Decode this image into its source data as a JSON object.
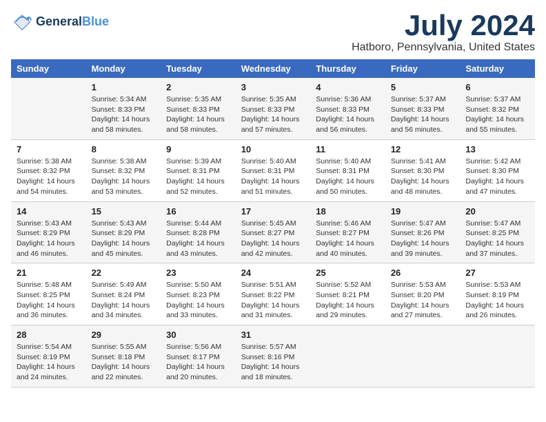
{
  "header": {
    "logo_line1": "General",
    "logo_line2": "Blue",
    "month_title": "July 2024",
    "location": "Hatboro, Pennsylvania, United States"
  },
  "weekdays": [
    "Sunday",
    "Monday",
    "Tuesday",
    "Wednesday",
    "Thursday",
    "Friday",
    "Saturday"
  ],
  "weeks": [
    [
      {
        "day": "",
        "sunrise": "",
        "sunset": "",
        "daylight": ""
      },
      {
        "day": "1",
        "sunrise": "Sunrise: 5:34 AM",
        "sunset": "Sunset: 8:33 PM",
        "daylight": "Daylight: 14 hours and 58 minutes."
      },
      {
        "day": "2",
        "sunrise": "Sunrise: 5:35 AM",
        "sunset": "Sunset: 8:33 PM",
        "daylight": "Daylight: 14 hours and 58 minutes."
      },
      {
        "day": "3",
        "sunrise": "Sunrise: 5:35 AM",
        "sunset": "Sunset: 8:33 PM",
        "daylight": "Daylight: 14 hours and 57 minutes."
      },
      {
        "day": "4",
        "sunrise": "Sunrise: 5:36 AM",
        "sunset": "Sunset: 8:33 PM",
        "daylight": "Daylight: 14 hours and 56 minutes."
      },
      {
        "day": "5",
        "sunrise": "Sunrise: 5:37 AM",
        "sunset": "Sunset: 8:33 PM",
        "daylight": "Daylight: 14 hours and 56 minutes."
      },
      {
        "day": "6",
        "sunrise": "Sunrise: 5:37 AM",
        "sunset": "Sunset: 8:32 PM",
        "daylight": "Daylight: 14 hours and 55 minutes."
      }
    ],
    [
      {
        "day": "7",
        "sunrise": "Sunrise: 5:38 AM",
        "sunset": "Sunset: 8:32 PM",
        "daylight": "Daylight: 14 hours and 54 minutes."
      },
      {
        "day": "8",
        "sunrise": "Sunrise: 5:38 AM",
        "sunset": "Sunset: 8:32 PM",
        "daylight": "Daylight: 14 hours and 53 minutes."
      },
      {
        "day": "9",
        "sunrise": "Sunrise: 5:39 AM",
        "sunset": "Sunset: 8:31 PM",
        "daylight": "Daylight: 14 hours and 52 minutes."
      },
      {
        "day": "10",
        "sunrise": "Sunrise: 5:40 AM",
        "sunset": "Sunset: 8:31 PM",
        "daylight": "Daylight: 14 hours and 51 minutes."
      },
      {
        "day": "11",
        "sunrise": "Sunrise: 5:40 AM",
        "sunset": "Sunset: 8:31 PM",
        "daylight": "Daylight: 14 hours and 50 minutes."
      },
      {
        "day": "12",
        "sunrise": "Sunrise: 5:41 AM",
        "sunset": "Sunset: 8:30 PM",
        "daylight": "Daylight: 14 hours and 48 minutes."
      },
      {
        "day": "13",
        "sunrise": "Sunrise: 5:42 AM",
        "sunset": "Sunset: 8:30 PM",
        "daylight": "Daylight: 14 hours and 47 minutes."
      }
    ],
    [
      {
        "day": "14",
        "sunrise": "Sunrise: 5:43 AM",
        "sunset": "Sunset: 8:29 PM",
        "daylight": "Daylight: 14 hours and 46 minutes."
      },
      {
        "day": "15",
        "sunrise": "Sunrise: 5:43 AM",
        "sunset": "Sunset: 8:29 PM",
        "daylight": "Daylight: 14 hours and 45 minutes."
      },
      {
        "day": "16",
        "sunrise": "Sunrise: 5:44 AM",
        "sunset": "Sunset: 8:28 PM",
        "daylight": "Daylight: 14 hours and 43 minutes."
      },
      {
        "day": "17",
        "sunrise": "Sunrise: 5:45 AM",
        "sunset": "Sunset: 8:27 PM",
        "daylight": "Daylight: 14 hours and 42 minutes."
      },
      {
        "day": "18",
        "sunrise": "Sunrise: 5:46 AM",
        "sunset": "Sunset: 8:27 PM",
        "daylight": "Daylight: 14 hours and 40 minutes."
      },
      {
        "day": "19",
        "sunrise": "Sunrise: 5:47 AM",
        "sunset": "Sunset: 8:26 PM",
        "daylight": "Daylight: 14 hours and 39 minutes."
      },
      {
        "day": "20",
        "sunrise": "Sunrise: 5:47 AM",
        "sunset": "Sunset: 8:25 PM",
        "daylight": "Daylight: 14 hours and 37 minutes."
      }
    ],
    [
      {
        "day": "21",
        "sunrise": "Sunrise: 5:48 AM",
        "sunset": "Sunset: 8:25 PM",
        "daylight": "Daylight: 14 hours and 36 minutes."
      },
      {
        "day": "22",
        "sunrise": "Sunrise: 5:49 AM",
        "sunset": "Sunset: 8:24 PM",
        "daylight": "Daylight: 14 hours and 34 minutes."
      },
      {
        "day": "23",
        "sunrise": "Sunrise: 5:50 AM",
        "sunset": "Sunset: 8:23 PM",
        "daylight": "Daylight: 14 hours and 33 minutes."
      },
      {
        "day": "24",
        "sunrise": "Sunrise: 5:51 AM",
        "sunset": "Sunset: 8:22 PM",
        "daylight": "Daylight: 14 hours and 31 minutes."
      },
      {
        "day": "25",
        "sunrise": "Sunrise: 5:52 AM",
        "sunset": "Sunset: 8:21 PM",
        "daylight": "Daylight: 14 hours and 29 minutes."
      },
      {
        "day": "26",
        "sunrise": "Sunrise: 5:53 AM",
        "sunset": "Sunset: 8:20 PM",
        "daylight": "Daylight: 14 hours and 27 minutes."
      },
      {
        "day": "27",
        "sunrise": "Sunrise: 5:53 AM",
        "sunset": "Sunset: 8:19 PM",
        "daylight": "Daylight: 14 hours and 26 minutes."
      }
    ],
    [
      {
        "day": "28",
        "sunrise": "Sunrise: 5:54 AM",
        "sunset": "Sunset: 8:19 PM",
        "daylight": "Daylight: 14 hours and 24 minutes."
      },
      {
        "day": "29",
        "sunrise": "Sunrise: 5:55 AM",
        "sunset": "Sunset: 8:18 PM",
        "daylight": "Daylight: 14 hours and 22 minutes."
      },
      {
        "day": "30",
        "sunrise": "Sunrise: 5:56 AM",
        "sunset": "Sunset: 8:17 PM",
        "daylight": "Daylight: 14 hours and 20 minutes."
      },
      {
        "day": "31",
        "sunrise": "Sunrise: 5:57 AM",
        "sunset": "Sunset: 8:16 PM",
        "daylight": "Daylight: 14 hours and 18 minutes."
      },
      {
        "day": "",
        "sunrise": "",
        "sunset": "",
        "daylight": ""
      },
      {
        "day": "",
        "sunrise": "",
        "sunset": "",
        "daylight": ""
      },
      {
        "day": "",
        "sunrise": "",
        "sunset": "",
        "daylight": ""
      }
    ]
  ]
}
